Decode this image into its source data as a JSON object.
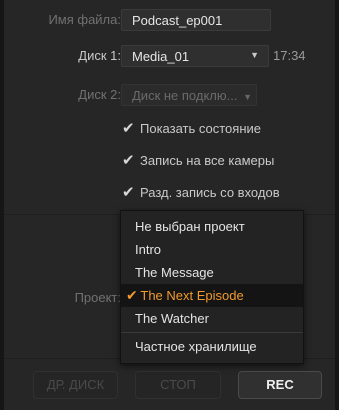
{
  "form": {
    "filename_label": "Имя файла:",
    "filename_value": "Podcast_ep001",
    "disk1_label": "Диск 1:",
    "disk1_value": "Media_01",
    "disk1_time": "17:34",
    "disk2_label": "Диск 2:",
    "disk2_value": "Диск не подклю...",
    "project_label": "Проект:"
  },
  "checkboxes": [
    {
      "label": "Показать состояние",
      "checked": true
    },
    {
      "label": "Запись на все камеры",
      "checked": true
    },
    {
      "label": "Разд. запись со входов",
      "checked": true
    }
  ],
  "project_menu": {
    "items": [
      "Не выбран проект",
      "Intro",
      "The Message",
      "The Next Episode",
      "The Watcher"
    ],
    "selected": "The Next Episode",
    "extra_item": "Частное хранилище"
  },
  "buttons": {
    "other_disk": "ДР. ДИСК",
    "stop": "СТОП",
    "rec": "REC"
  },
  "icons": {
    "check": "check-icon",
    "dropdown": "chevron-down-icon"
  },
  "colors": {
    "accent": "#f29a2e",
    "background": "#262626"
  }
}
